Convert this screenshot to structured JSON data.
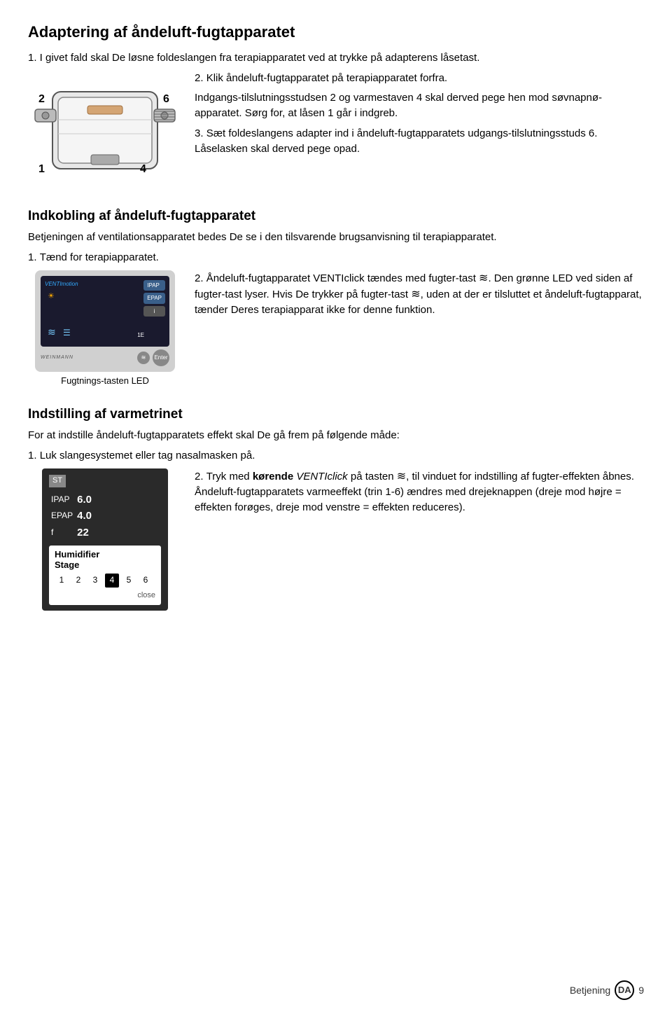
{
  "page": {
    "title": "Adaptering af åndeluft-fugtapparatet",
    "section1": {
      "intro": "1. I givet fald skal De løsne foldeslangen fra terapiapparatet ved at trykke på adapterens låsetast.",
      "step2_label": "2.",
      "step2": "Klik åndeluft-fugtapparatet på terapiapparatet forfra.",
      "step2b": "Indgangs-tilslutningsstudsen 2 og varmestaven 4 skal derved pege hen mod søvnapnø-apparatet. Sørg for, at låsen 1 går i indgreb.",
      "step3_label": "3.",
      "step3": "Sæt foldeslangens adapter ind i åndeluft-fugtapparatets udgangs-tilslutningsstuds 6. Låselasken skal derved pege opad.",
      "fig_label1": "2",
      "fig_label2": "6",
      "fig_label3": "1",
      "fig_label4": "4"
    },
    "section2": {
      "title": "Indkobling af åndeluft-fugtapparatet",
      "intro": "Betjeningen af ventilationsapparatet bedes De se i den tilsvarende brugsanvisning til terapiapparatet.",
      "step1_label": "1.",
      "step1": "Tænd for terapiapparatet.",
      "step2_label": "2.",
      "step2a": "Åndeluft-fugtapparatet VENTIclick tændes med fugter-tast ",
      "step2a_icon": "≋",
      "step2a_rest": ". Den grønne LED ved siden af fugter-tast lyser. Hvis De trykker på fugter-tast ",
      "step2b_icon": "≋",
      "step2b_rest": ", uden at der er tilsluttet et åndeluft-fugtapparat, tænder Deres terapiapparat ikke for denne funktion.",
      "fig_caption": "Fugtnings-tasten LED",
      "device_brand": "VENTImotion",
      "device_buttons": [
        "IPAP",
        "EPAP",
        "iE"
      ],
      "device_enter": "Enter",
      "device_logo": "WEINMANN"
    },
    "section3": {
      "title": "Indstilling af varmetrinet",
      "intro": "For at indstille åndeluft-fugtapparatets effekt skal De gå frem på følgende måde:",
      "step1_label": "1.",
      "step1": "Luk slangesystemet eller tag nasalmasken på.",
      "step2_label": "2.",
      "step2a": "Tryk med ",
      "step2a_bold": "kørende",
      "step2a_italic": "VENTIclick",
      "step2a_rest1": " på tasten ",
      "step2a_icon": "≋",
      "step2a_rest2": ", til vinduet for indstilling af fugter-effekten åbnes. Åndeluft-fugtapparatets varmeeffekt (trin 1-6) ændres med drejeknappen (dreje mod højre = effekten forøges, dreje mod venstre = effekten reduceres).",
      "screen": {
        "st_label": "ST",
        "ipap_label": "IPAP",
        "ipap_value": "6.0",
        "epap_label": "EPAP",
        "epap_value": "4.0",
        "f_label": "f",
        "f_value": "22",
        "humidifier_title_line1": "Humidifier",
        "humidifier_title_line2": "Stage",
        "stages": [
          "1",
          "2",
          "3",
          "4",
          "5",
          "6"
        ],
        "active_stage": "4",
        "close_label": "close"
      }
    },
    "footer": {
      "label": "Betjening",
      "lang": "DA",
      "page_number": "9"
    }
  }
}
